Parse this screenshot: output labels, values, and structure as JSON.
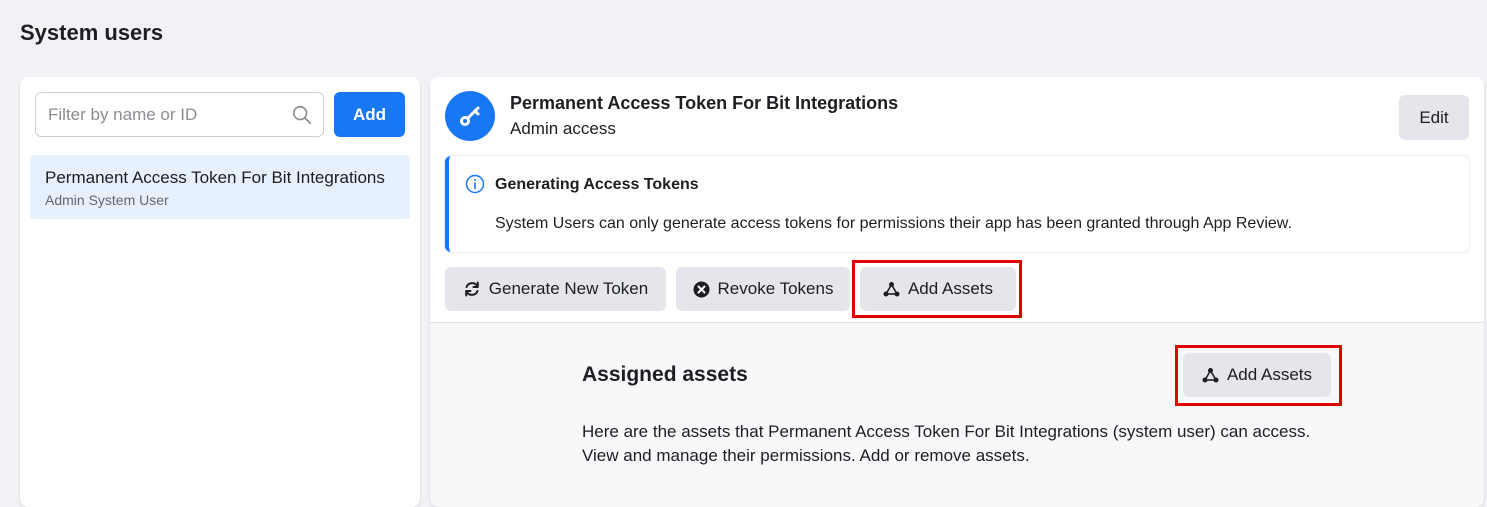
{
  "page": {
    "title": "System users"
  },
  "sidebar": {
    "search": {
      "placeholder": "Filter by name or ID",
      "value": ""
    },
    "add_label": "Add",
    "users": [
      {
        "name": "Permanent Access Token For Bit Integrations",
        "role": "Admin System User",
        "selected": true
      }
    ]
  },
  "detail": {
    "name": "Permanent Access Token For Bit Integrations",
    "role": "Admin access",
    "edit_label": "Edit",
    "notice": {
      "title": "Generating Access Tokens",
      "body": "System Users can only generate access tokens for permissions their app has been granted through App Review."
    },
    "actions": {
      "generate_label": "Generate New Token",
      "revoke_label": "Revoke Tokens",
      "add_assets_label": "Add Assets"
    },
    "assets": {
      "title": "Assigned assets",
      "add_assets_label": "Add Assets",
      "description_line1": "Here are the assets that Permanent Access Token For Bit Integrations (system user) can access.",
      "description_line2": "View and manage their permissions. Add or remove assets."
    }
  },
  "icons": {
    "avatar": "key-icon",
    "search": "search-icon",
    "info": "info-icon",
    "generate": "refresh-icon",
    "revoke": "close-circle-icon",
    "assets": "assets-icon"
  },
  "colors": {
    "accent": "#1877f2",
    "highlight": "#e00000",
    "selected": "#e7f0fd"
  }
}
